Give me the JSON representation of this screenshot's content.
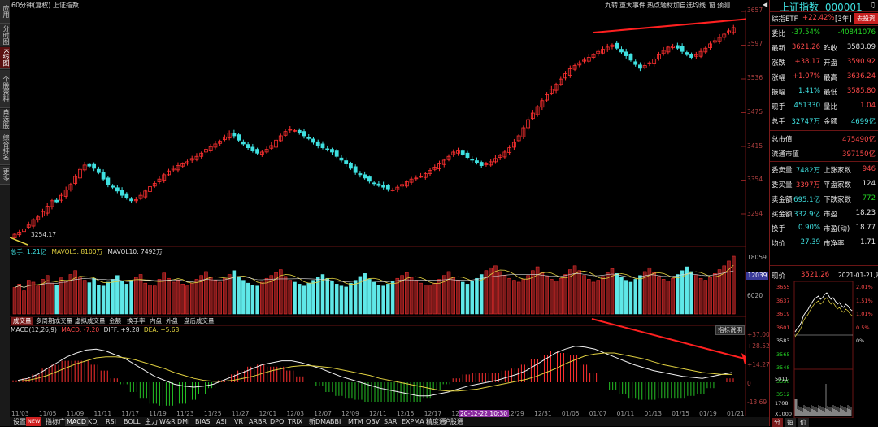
{
  "left_tabs": [
    "应用",
    "分时图",
    "K线图",
    "个股资料",
    "自选股",
    "综合排名",
    "更多"
  ],
  "header": {
    "chart_title": "60分钟(复权)  上证指数",
    "buttons": [
      "九转",
      "重大事件",
      "热点题材",
      "加自选",
      "均线",
      "窗",
      "预测"
    ]
  },
  "stock": {
    "name": "上证指数",
    "code": "000001"
  },
  "price_axis": [
    "3657",
    "3597",
    "3536",
    "3475",
    "3415",
    "3354",
    "3294"
  ],
  "low_mark": "3254.17",
  "volume": {
    "label_total": "总手: 1.21亿",
    "label_ma5": "MAVOL5: 8100万",
    "label_ma10": "MAVOL10: 7492万",
    "axis": [
      "18059",
      "12039",
      "6020"
    ]
  },
  "sub_tabs": [
    "成交量",
    "多周期成交量",
    "虚拟成交量",
    "金额",
    "换手率",
    "内盘",
    "外盘",
    "盘后成交量"
  ],
  "macd": {
    "label": "MACD(12,26,9)",
    "macd_val": "MACD: -7.20",
    "diff_val": "DIFF: +9.28",
    "dea_val": "DEA: +5.68",
    "help_btn": "指标说明",
    "axis": [
      "+37.00",
      "+28.52",
      "+14.27",
      "0",
      "-13.69"
    ]
  },
  "x_axis": [
    "11/03",
    "11/05",
    "11/09",
    "11/11",
    "11/17",
    "11/19",
    "11/23",
    "11/25",
    "11/27",
    "12/01",
    "12/03",
    "12/07",
    "12/09",
    "12/11",
    "12/15",
    "12/17",
    "12/21",
    "12/25",
    "12/29",
    "12/31",
    "01/05",
    "01/07",
    "01/11",
    "01/13",
    "01/15",
    "01/19",
    "01/21"
  ],
  "time_cursor": "20-12-22 10:30",
  "bottom_tabs": [
    "设置",
    "NEW",
    "指标广场",
    "MACD",
    "KDJ",
    "RSI",
    "BOLL",
    "主力",
    "W&R",
    "DMI",
    "BIAS",
    "ASI",
    "VR",
    "ARBR",
    "DPO",
    "TRIX",
    "新DMA",
    "BBI",
    "MTM",
    "OBV",
    "SAR",
    "EXPMA",
    "精度通",
    "沪股通"
  ],
  "right_panel": {
    "etf_label": "综指ETF",
    "etf_pct": "+22.42%",
    "etf_period": "[3年]",
    "invest_btn": "去投资",
    "quote": [
      {
        "l1": "委比",
        "v1": "-37.54%",
        "l2": "",
        "v2": "-40841076"
      },
      {
        "l1": "最新",
        "v1": "3621.26",
        "l2": "昨收",
        "v2": "3583.09"
      },
      {
        "l1": "涨跌",
        "v1": "+38.17",
        "l2": "开盘",
        "v2": "3590.92"
      },
      {
        "l1": "涨幅",
        "v1": "+1.07%",
        "l2": "最高",
        "v2": "3636.24"
      },
      {
        "l1": "振幅",
        "v1": "1.41%",
        "l2": "最低",
        "v2": "3585.80"
      },
      {
        "l1": "现手",
        "v1": "451330",
        "l2": "量比",
        "v2": "1.04"
      },
      {
        "l1": "总手",
        "v1": "32747万",
        "l2": "金额",
        "v2": "4699亿"
      }
    ],
    "market": [
      {
        "l": "总市值",
        "v": "475490亿"
      },
      {
        "l": "流通市值",
        "v": "397150亿"
      }
    ],
    "breadth": [
      {
        "l1": "委卖量",
        "v1": "7482万",
        "l2": "上涨家数",
        "v2": "946"
      },
      {
        "l1": "委买量",
        "v1": "3397万",
        "l2": "平盘家数",
        "v2": "124"
      },
      {
        "l1": "卖金额",
        "v1": "695.1亿",
        "l2": "下跌家数",
        "v2": "772"
      },
      {
        "l1": "买金额",
        "v1": "332.9亿",
        "l2": "市盈",
        "v2": "18.23"
      },
      {
        "l1": "换手",
        "v1": "0.90%",
        "l2": "市盈(动)",
        "v2": "18.77"
      },
      {
        "l1": "均价",
        "v1": "27.39",
        "l2": "市净率",
        "v2": "1.71"
      }
    ],
    "mini": {
      "label": "现价",
      "price": "3521.26",
      "date": "2021-01-21,四",
      "left_axis": [
        "3655",
        "3637",
        "3619",
        "3601",
        "3583",
        "3565",
        "3548",
        "3530",
        "3512"
      ],
      "right_axis": [
        "2.01%",
        "1.51%",
        "1.01%",
        "0.5%",
        "0%"
      ],
      "vol_top": "5011",
      "vol_mid": "1708",
      "vol_unit": "X1000",
      "tabs": [
        "分",
        "每",
        "价"
      ]
    }
  },
  "chart_data": {
    "type": "candlestick",
    "ylim": [
      3240,
      3670
    ],
    "series_note": "",
    "closes": [
      3258,
      3262,
      3268,
      3275,
      3285,
      3290,
      3300,
      3310,
      3320,
      3318,
      3330,
      3340,
      3350,
      3365,
      3378,
      3386,
      3384,
      3380,
      3372,
      3360,
      3350,
      3345,
      3338,
      3330,
      3325,
      3320,
      3322,
      3330,
      3338,
      3346,
      3352,
      3360,
      3368,
      3375,
      3380,
      3385,
      3388,
      3392,
      3398,
      3402,
      3408,
      3415,
      3420,
      3425,
      3430,
      3438,
      3445,
      3440,
      3432,
      3425,
      3418,
      3412,
      3408,
      3410,
      3415,
      3422,
      3432,
      3440,
      3448,
      3452,
      3450,
      3446,
      3440,
      3435,
      3428,
      3422,
      3418,
      3415,
      3410,
      3402,
      3395,
      3388,
      3380,
      3372,
      3368,
      3362,
      3356,
      3352,
      3348,
      3345,
      3342,
      3340,
      3345,
      3350,
      3355,
      3360,
      3362,
      3365,
      3370,
      3376,
      3382,
      3388,
      3395,
      3402,
      3410,
      3412,
      3406,
      3400,
      3395,
      3390,
      3385,
      3388,
      3392,
      3398,
      3404,
      3410,
      3418,
      3428,
      3440,
      3455,
      3470,
      3482,
      3494,
      3505,
      3516,
      3526,
      3535,
      3545,
      3555,
      3564,
      3570,
      3575,
      3580,
      3585,
      3590,
      3596,
      3600,
      3604,
      3608,
      3602,
      3595,
      3588,
      3580,
      3572,
      3565,
      3570,
      3575,
      3582,
      3590,
      3598,
      3604,
      3606,
      3602,
      3596,
      3590,
      3585,
      3590,
      3596,
      3602,
      3610,
      3616,
      3622,
      3628,
      3634,
      3640
    ],
    "volumes": [
      55,
      62,
      48,
      70,
      66,
      58,
      72,
      80,
      64,
      60,
      75,
      68,
      82,
      90,
      77,
      70,
      65,
      74,
      60,
      58,
      66,
      72,
      80,
      68,
      62,
      70,
      76,
      82,
      64,
      60,
      58,
      72,
      85,
      74,
      66,
      70,
      62,
      58,
      64,
      72,
      80,
      88,
      76,
      70,
      66,
      74,
      82,
      90,
      78,
      70,
      64,
      60,
      58,
      66,
      74,
      80,
      86,
      92,
      78,
      70,
      66,
      62,
      58,
      64,
      70,
      76,
      82,
      74,
      68,
      62,
      58,
      56,
      64,
      70,
      78,
      84,
      72,
      66,
      60,
      58,
      62,
      68,
      74,
      80,
      86,
      76,
      70,
      64,
      60,
      58,
      64,
      72,
      80,
      88,
      76,
      70,
      66,
      62,
      68,
      74,
      82,
      90,
      96,
      100,
      88,
      80,
      74,
      70,
      66,
      72,
      80,
      90,
      98,
      86,
      78,
      72,
      68,
      74,
      82,
      92,
      100,
      90,
      80,
      72,
      66,
      70,
      78,
      86,
      94,
      84,
      76,
      70,
      66,
      72,
      80,
      88,
      96,
      86,
      78,
      72,
      68,
      74,
      82,
      90,
      98,
      88,
      80,
      74,
      70,
      76,
      84,
      92,
      100,
      110,
      120
    ],
    "diff": [
      2,
      4,
      8,
      14,
      20,
      26,
      30,
      33,
      34,
      32,
      28,
      24,
      18,
      12,
      6,
      2,
      -2,
      -4,
      -5,
      -4,
      -2,
      2,
      6,
      10,
      14,
      18,
      20,
      22,
      22,
      20,
      17,
      14,
      10,
      6,
      3,
      0,
      -3,
      -6,
      -8,
      -10,
      -12,
      -14,
      -14,
      -12,
      -10,
      -7,
      -4,
      -2,
      0,
      2,
      5,
      8,
      12,
      18,
      24,
      30,
      34,
      37,
      36,
      34,
      30,
      26,
      22,
      18,
      15,
      12,
      10,
      8,
      6,
      5,
      4,
      6,
      8,
      10
    ],
    "dea": [
      1,
      2,
      4,
      7,
      11,
      15,
      19,
      22,
      25,
      26,
      26,
      25,
      23,
      20,
      17,
      14,
      10,
      7,
      4,
      2,
      1,
      1,
      2,
      4,
      6,
      9,
      12,
      14,
      16,
      17,
      17,
      16,
      15,
      13,
      11,
      9,
      7,
      4,
      2,
      0,
      -2,
      -4,
      -6,
      -8,
      -9,
      -9,
      -8,
      -7,
      -5,
      -3,
      -1,
      1,
      3,
      6,
      10,
      14,
      19,
      23,
      27,
      29,
      30,
      30,
      28,
      26,
      24,
      21,
      18,
      16,
      14,
      12,
      10,
      9,
      8,
      8
    ]
  }
}
